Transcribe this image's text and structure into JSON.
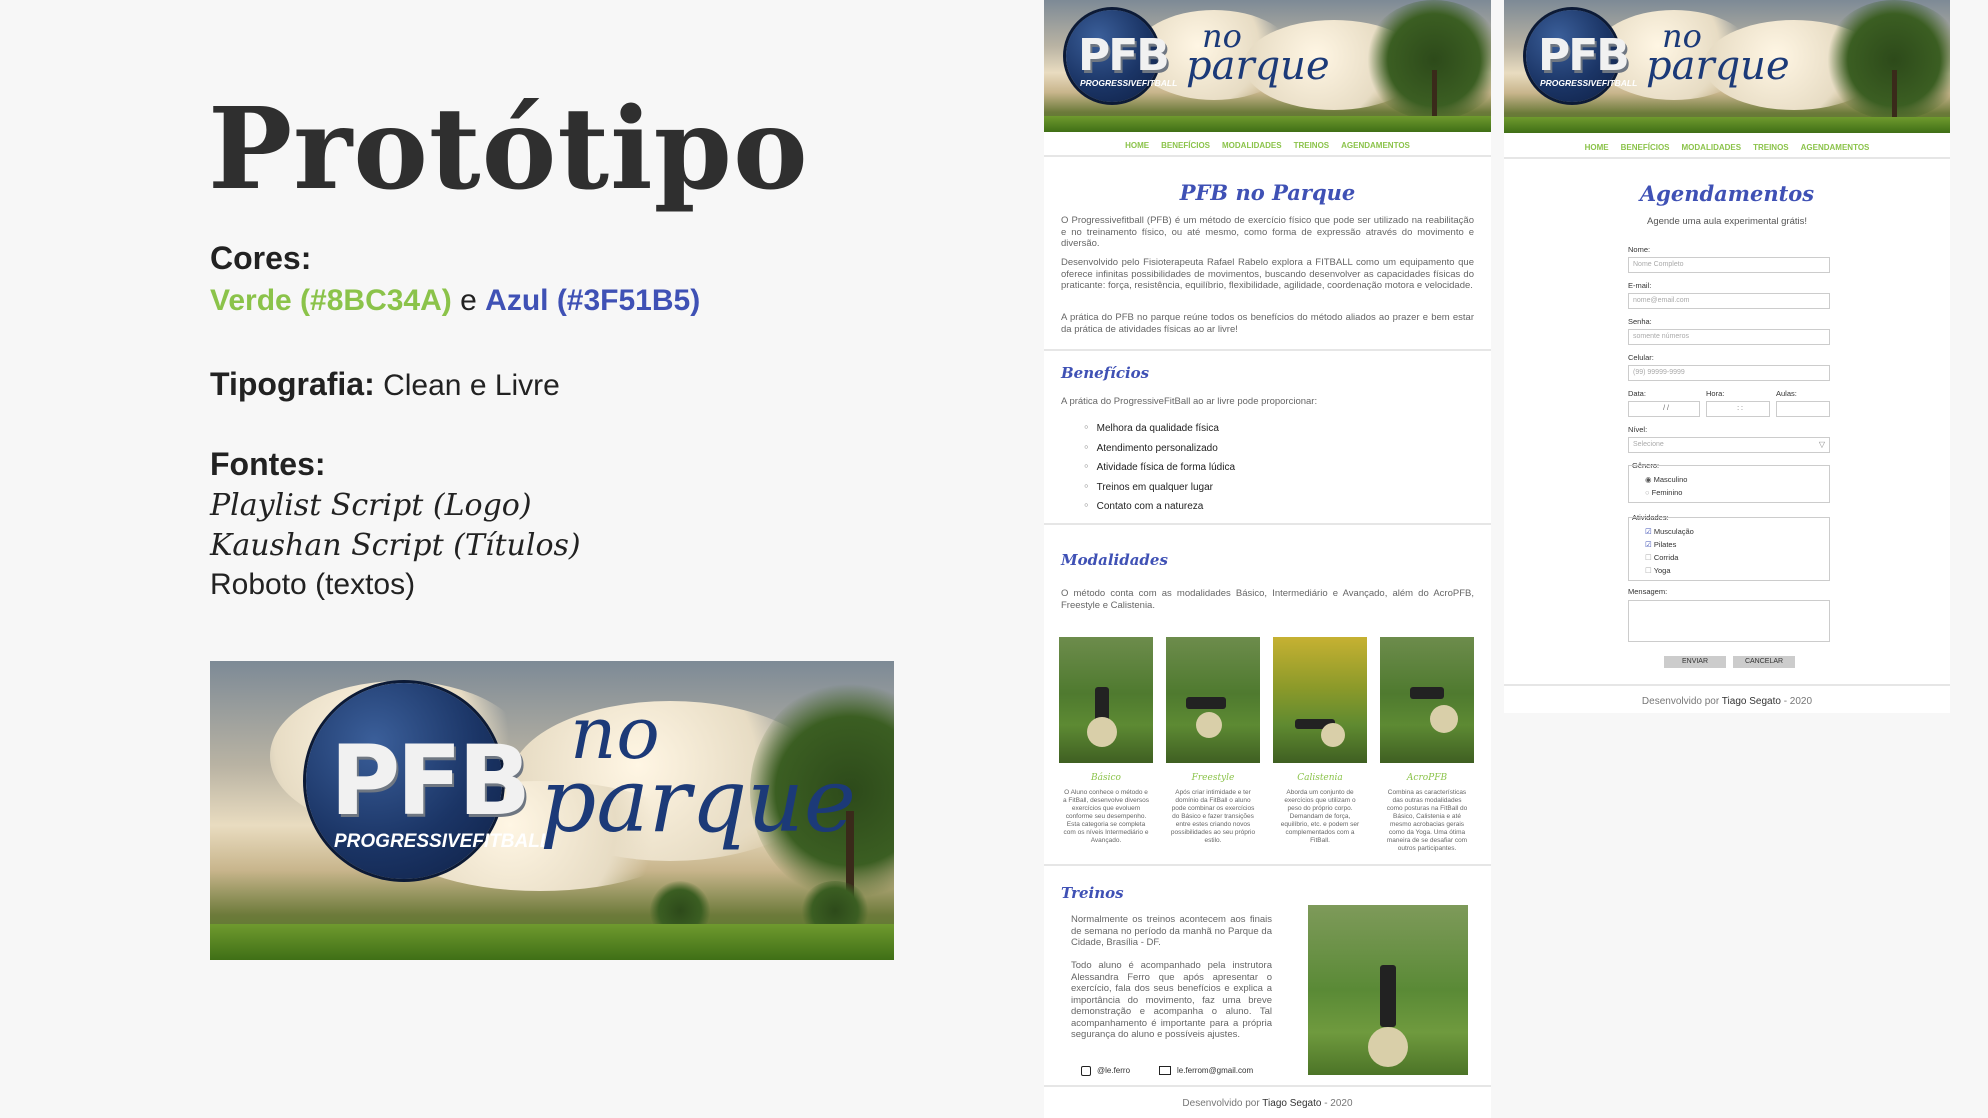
{
  "title": "Protótipo",
  "colors": {
    "heading": "Cores:",
    "green_label": "Verde (#8BC34A)",
    "joiner": "e",
    "blue_label": "Azul (#3F51B5)",
    "green": "#8BC34A",
    "blue": "#3F51B5"
  },
  "typography": {
    "heading": "Tipografia:",
    "value": "Clean e Livre"
  },
  "fonts": {
    "heading": "Fontes:",
    "logo": "Playlist Script (Logo)",
    "titles": "Kaushan Script (Títulos)",
    "texts": "Roboto (textos)"
  },
  "logo": {
    "pfb": "PFB",
    "brand": "PROGRESSIVEFITBALL",
    "no": "no",
    "parque": "parque"
  },
  "nav": [
    "HOME",
    "BENEFÍCIOS",
    "MODALIDADES",
    "TREINOS",
    "AGENDAMENTOS"
  ],
  "home": {
    "title": "PFB no Parque",
    "p1": "O Progressivefitball (PFB) é um método de exercício físico que pode ser utilizado na reabilitação e no treinamento físico, ou até mesmo, como forma de expressão através do movimento e diversão.",
    "p2": "Desenvolvido pelo Fisioterapeuta Rafael Rabelo explora a FITBALL como um equipamento que oferece infinitas possibilidades de movimentos, buscando desenvolver as capacidades físicas do praticante: força, resistência, equilíbrio, flexibilidade, agilidade, coordenação motora e velocidade.",
    "p3": "A prática do PFB no parque reúne todos os benefícios do método aliados ao prazer e bem estar da prática de atividades físicas ao ar livre!",
    "beneficios_title": "Benefícios",
    "beneficios_intro": "A prática do ProgressiveFitBall ao ar livre pode proporcionar:",
    "beneficios": [
      "Melhora da qualidade física",
      "Atendimento personalizado",
      "Atividade física de forma lúdica",
      "Treinos em qualquer lugar",
      "Contato com a natureza"
    ],
    "modalidades_title": "Modalidades",
    "modalidades_intro": "O método conta com as modalidades Básico, Intermediário e Avançado, além do AcroPFB, Freestyle e Calistenia.",
    "modalidades": [
      {
        "name": "Básico",
        "text": "O Aluno conhece o método e a FitBall, desenvolve diversos exercícios que evoluem conforme seu desempenho. Esta categoria se completa com os níveis Intermediário e Avançado."
      },
      {
        "name": "Freestyle",
        "text": "Após criar intimidade e ter domínio da FitBall o aluno pode combinar os exercícios do Básico e fazer transições entre estes criando novos possibilidades ao seu próprio estilo."
      },
      {
        "name": "Calistenia",
        "text": "Aborda um conjunto de exercícios que utilizam o peso do próprio corpo. Demandam de força, equilíbrio, etc. e podem ser complementados com a FitBall."
      },
      {
        "name": "AcroPFB",
        "text": "Combina as características das outras modalidades como posturas na FitBall do Básico, Calistenia e até mesmo acrobacias gerais como da Yoga. Uma ótima maneira de se desafiar com outros participantes."
      }
    ],
    "treinos_title": "Treinos",
    "treinos_p1": "Normalmente os treinos acontecem aos finais de semana no período da manhã no Parque da Cidade, Brasília - DF.",
    "treinos_p2": "Todo aluno é acompanhado pela instrutora Alessandra Ferro que após apresentar o exercício, fala dos seus benefícios e explica a importância do movimento, faz uma breve demonstração e acompanha o aluno. Tal acompanhamento é importante para a própria segurança do aluno e possíveis ajustes.",
    "instagram": "@le.ferro",
    "email": "le.ferrom@gmail.com",
    "footer_prefix": "Desenvolvido por",
    "footer_name": "Tiago Segato",
    "footer_year": "- 2020"
  },
  "form": {
    "title": "Agendamentos",
    "subtitle": "Agende uma aula experimental grátis!",
    "nome_label": "Nome:",
    "nome_ph": "Nome Completo",
    "email_label": "E-mail:",
    "email_ph": "nome@email.com",
    "senha_label": "Senha:",
    "senha_ph": "somente números",
    "celular_label": "Celular:",
    "celular_ph": "(99) 99999-9999",
    "data_label": "Data:",
    "data_value": "/ /",
    "hora_label": "Hora:",
    "hora_value": ": :",
    "aulas_label": "Aulas:",
    "nivel_label": "Nível:",
    "nivel_value": "Selecione",
    "genero_label": "Gênero:",
    "genero": [
      "Masculino",
      "Feminino"
    ],
    "atividades_label": "Atividades:",
    "atividades": [
      "Musculação",
      "Pilates",
      "Corrida",
      "Yoga"
    ],
    "mensagem_label": "Mensagem:",
    "enviar": "ENVIAR",
    "cancelar": "CANCELAR"
  }
}
